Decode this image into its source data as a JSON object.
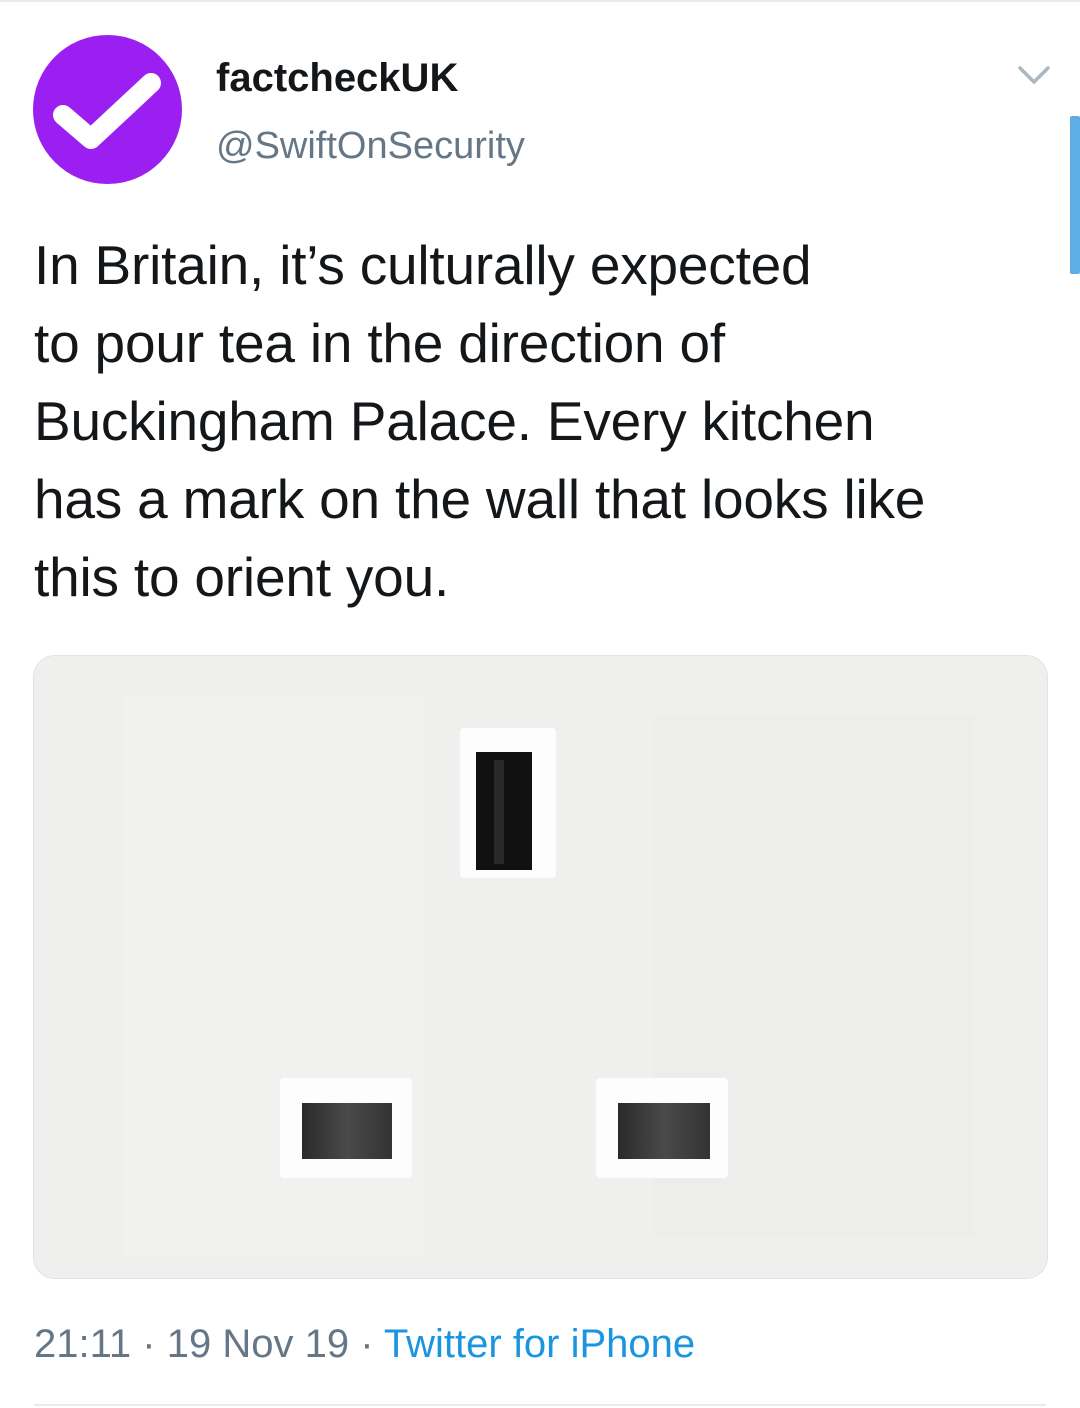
{
  "tweet": {
    "display_name": "factcheckUK",
    "handle": "@SwiftOnSecurity",
    "text": "In Britain, it’s culturally expected\nto pour tea in the direction of\nBuckingham Palace. Every kitchen\nhas a mark on the wall that looks like\nthis to orient you.",
    "time": "21:11",
    "date": "19 Nov 19",
    "source": "Twitter for iPhone",
    "separator": "·"
  },
  "icons": {
    "avatar": "checkmark-icon",
    "menu": "chevron-down-icon"
  },
  "colors": {
    "avatar_bg": "#9b1ff0",
    "link": "#1b95e0",
    "secondary_text": "#657786",
    "scroll_indicator": "#5daee8"
  }
}
